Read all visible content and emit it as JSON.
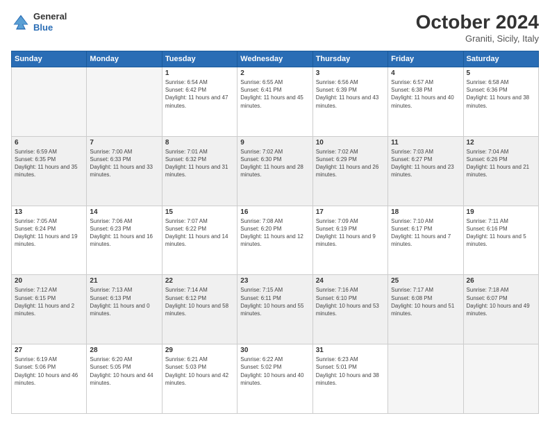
{
  "header": {
    "logo_line1": "General",
    "logo_line2": "Blue",
    "month": "October 2024",
    "location": "Graniti, Sicily, Italy"
  },
  "days_of_week": [
    "Sunday",
    "Monday",
    "Tuesday",
    "Wednesday",
    "Thursday",
    "Friday",
    "Saturday"
  ],
  "weeks": [
    [
      {
        "day": "",
        "sunrise": "",
        "sunset": "",
        "daylight": "",
        "empty": true
      },
      {
        "day": "",
        "sunrise": "",
        "sunset": "",
        "daylight": "",
        "empty": true
      },
      {
        "day": "1",
        "sunrise": "Sunrise: 6:54 AM",
        "sunset": "Sunset: 6:42 PM",
        "daylight": "Daylight: 11 hours and 47 minutes.",
        "empty": false
      },
      {
        "day": "2",
        "sunrise": "Sunrise: 6:55 AM",
        "sunset": "Sunset: 6:41 PM",
        "daylight": "Daylight: 11 hours and 45 minutes.",
        "empty": false
      },
      {
        "day": "3",
        "sunrise": "Sunrise: 6:56 AM",
        "sunset": "Sunset: 6:39 PM",
        "daylight": "Daylight: 11 hours and 43 minutes.",
        "empty": false
      },
      {
        "day": "4",
        "sunrise": "Sunrise: 6:57 AM",
        "sunset": "Sunset: 6:38 PM",
        "daylight": "Daylight: 11 hours and 40 minutes.",
        "empty": false
      },
      {
        "day": "5",
        "sunrise": "Sunrise: 6:58 AM",
        "sunset": "Sunset: 6:36 PM",
        "daylight": "Daylight: 11 hours and 38 minutes.",
        "empty": false
      }
    ],
    [
      {
        "day": "6",
        "sunrise": "Sunrise: 6:59 AM",
        "sunset": "Sunset: 6:35 PM",
        "daylight": "Daylight: 11 hours and 35 minutes.",
        "empty": false
      },
      {
        "day": "7",
        "sunrise": "Sunrise: 7:00 AM",
        "sunset": "Sunset: 6:33 PM",
        "daylight": "Daylight: 11 hours and 33 minutes.",
        "empty": false
      },
      {
        "day": "8",
        "sunrise": "Sunrise: 7:01 AM",
        "sunset": "Sunset: 6:32 PM",
        "daylight": "Daylight: 11 hours and 31 minutes.",
        "empty": false
      },
      {
        "day": "9",
        "sunrise": "Sunrise: 7:02 AM",
        "sunset": "Sunset: 6:30 PM",
        "daylight": "Daylight: 11 hours and 28 minutes.",
        "empty": false
      },
      {
        "day": "10",
        "sunrise": "Sunrise: 7:02 AM",
        "sunset": "Sunset: 6:29 PM",
        "daylight": "Daylight: 11 hours and 26 minutes.",
        "empty": false
      },
      {
        "day": "11",
        "sunrise": "Sunrise: 7:03 AM",
        "sunset": "Sunset: 6:27 PM",
        "daylight": "Daylight: 11 hours and 23 minutes.",
        "empty": false
      },
      {
        "day": "12",
        "sunrise": "Sunrise: 7:04 AM",
        "sunset": "Sunset: 6:26 PM",
        "daylight": "Daylight: 11 hours and 21 minutes.",
        "empty": false
      }
    ],
    [
      {
        "day": "13",
        "sunrise": "Sunrise: 7:05 AM",
        "sunset": "Sunset: 6:24 PM",
        "daylight": "Daylight: 11 hours and 19 minutes.",
        "empty": false
      },
      {
        "day": "14",
        "sunrise": "Sunrise: 7:06 AM",
        "sunset": "Sunset: 6:23 PM",
        "daylight": "Daylight: 11 hours and 16 minutes.",
        "empty": false
      },
      {
        "day": "15",
        "sunrise": "Sunrise: 7:07 AM",
        "sunset": "Sunset: 6:22 PM",
        "daylight": "Daylight: 11 hours and 14 minutes.",
        "empty": false
      },
      {
        "day": "16",
        "sunrise": "Sunrise: 7:08 AM",
        "sunset": "Sunset: 6:20 PM",
        "daylight": "Daylight: 11 hours and 12 minutes.",
        "empty": false
      },
      {
        "day": "17",
        "sunrise": "Sunrise: 7:09 AM",
        "sunset": "Sunset: 6:19 PM",
        "daylight": "Daylight: 11 hours and 9 minutes.",
        "empty": false
      },
      {
        "day": "18",
        "sunrise": "Sunrise: 7:10 AM",
        "sunset": "Sunset: 6:17 PM",
        "daylight": "Daylight: 11 hours and 7 minutes.",
        "empty": false
      },
      {
        "day": "19",
        "sunrise": "Sunrise: 7:11 AM",
        "sunset": "Sunset: 6:16 PM",
        "daylight": "Daylight: 11 hours and 5 minutes.",
        "empty": false
      }
    ],
    [
      {
        "day": "20",
        "sunrise": "Sunrise: 7:12 AM",
        "sunset": "Sunset: 6:15 PM",
        "daylight": "Daylight: 11 hours and 2 minutes.",
        "empty": false
      },
      {
        "day": "21",
        "sunrise": "Sunrise: 7:13 AM",
        "sunset": "Sunset: 6:13 PM",
        "daylight": "Daylight: 11 hours and 0 minutes.",
        "empty": false
      },
      {
        "day": "22",
        "sunrise": "Sunrise: 7:14 AM",
        "sunset": "Sunset: 6:12 PM",
        "daylight": "Daylight: 10 hours and 58 minutes.",
        "empty": false
      },
      {
        "day": "23",
        "sunrise": "Sunrise: 7:15 AM",
        "sunset": "Sunset: 6:11 PM",
        "daylight": "Daylight: 10 hours and 55 minutes.",
        "empty": false
      },
      {
        "day": "24",
        "sunrise": "Sunrise: 7:16 AM",
        "sunset": "Sunset: 6:10 PM",
        "daylight": "Daylight: 10 hours and 53 minutes.",
        "empty": false
      },
      {
        "day": "25",
        "sunrise": "Sunrise: 7:17 AM",
        "sunset": "Sunset: 6:08 PM",
        "daylight": "Daylight: 10 hours and 51 minutes.",
        "empty": false
      },
      {
        "day": "26",
        "sunrise": "Sunrise: 7:18 AM",
        "sunset": "Sunset: 6:07 PM",
        "daylight": "Daylight: 10 hours and 49 minutes.",
        "empty": false
      }
    ],
    [
      {
        "day": "27",
        "sunrise": "Sunrise: 6:19 AM",
        "sunset": "Sunset: 5:06 PM",
        "daylight": "Daylight: 10 hours and 46 minutes.",
        "empty": false
      },
      {
        "day": "28",
        "sunrise": "Sunrise: 6:20 AM",
        "sunset": "Sunset: 5:05 PM",
        "daylight": "Daylight: 10 hours and 44 minutes.",
        "empty": false
      },
      {
        "day": "29",
        "sunrise": "Sunrise: 6:21 AM",
        "sunset": "Sunset: 5:03 PM",
        "daylight": "Daylight: 10 hours and 42 minutes.",
        "empty": false
      },
      {
        "day": "30",
        "sunrise": "Sunrise: 6:22 AM",
        "sunset": "Sunset: 5:02 PM",
        "daylight": "Daylight: 10 hours and 40 minutes.",
        "empty": false
      },
      {
        "day": "31",
        "sunrise": "Sunrise: 6:23 AM",
        "sunset": "Sunset: 5:01 PM",
        "daylight": "Daylight: 10 hours and 38 minutes.",
        "empty": false
      },
      {
        "day": "",
        "sunrise": "",
        "sunset": "",
        "daylight": "",
        "empty": true
      },
      {
        "day": "",
        "sunrise": "",
        "sunset": "",
        "daylight": "",
        "empty": true
      }
    ]
  ]
}
